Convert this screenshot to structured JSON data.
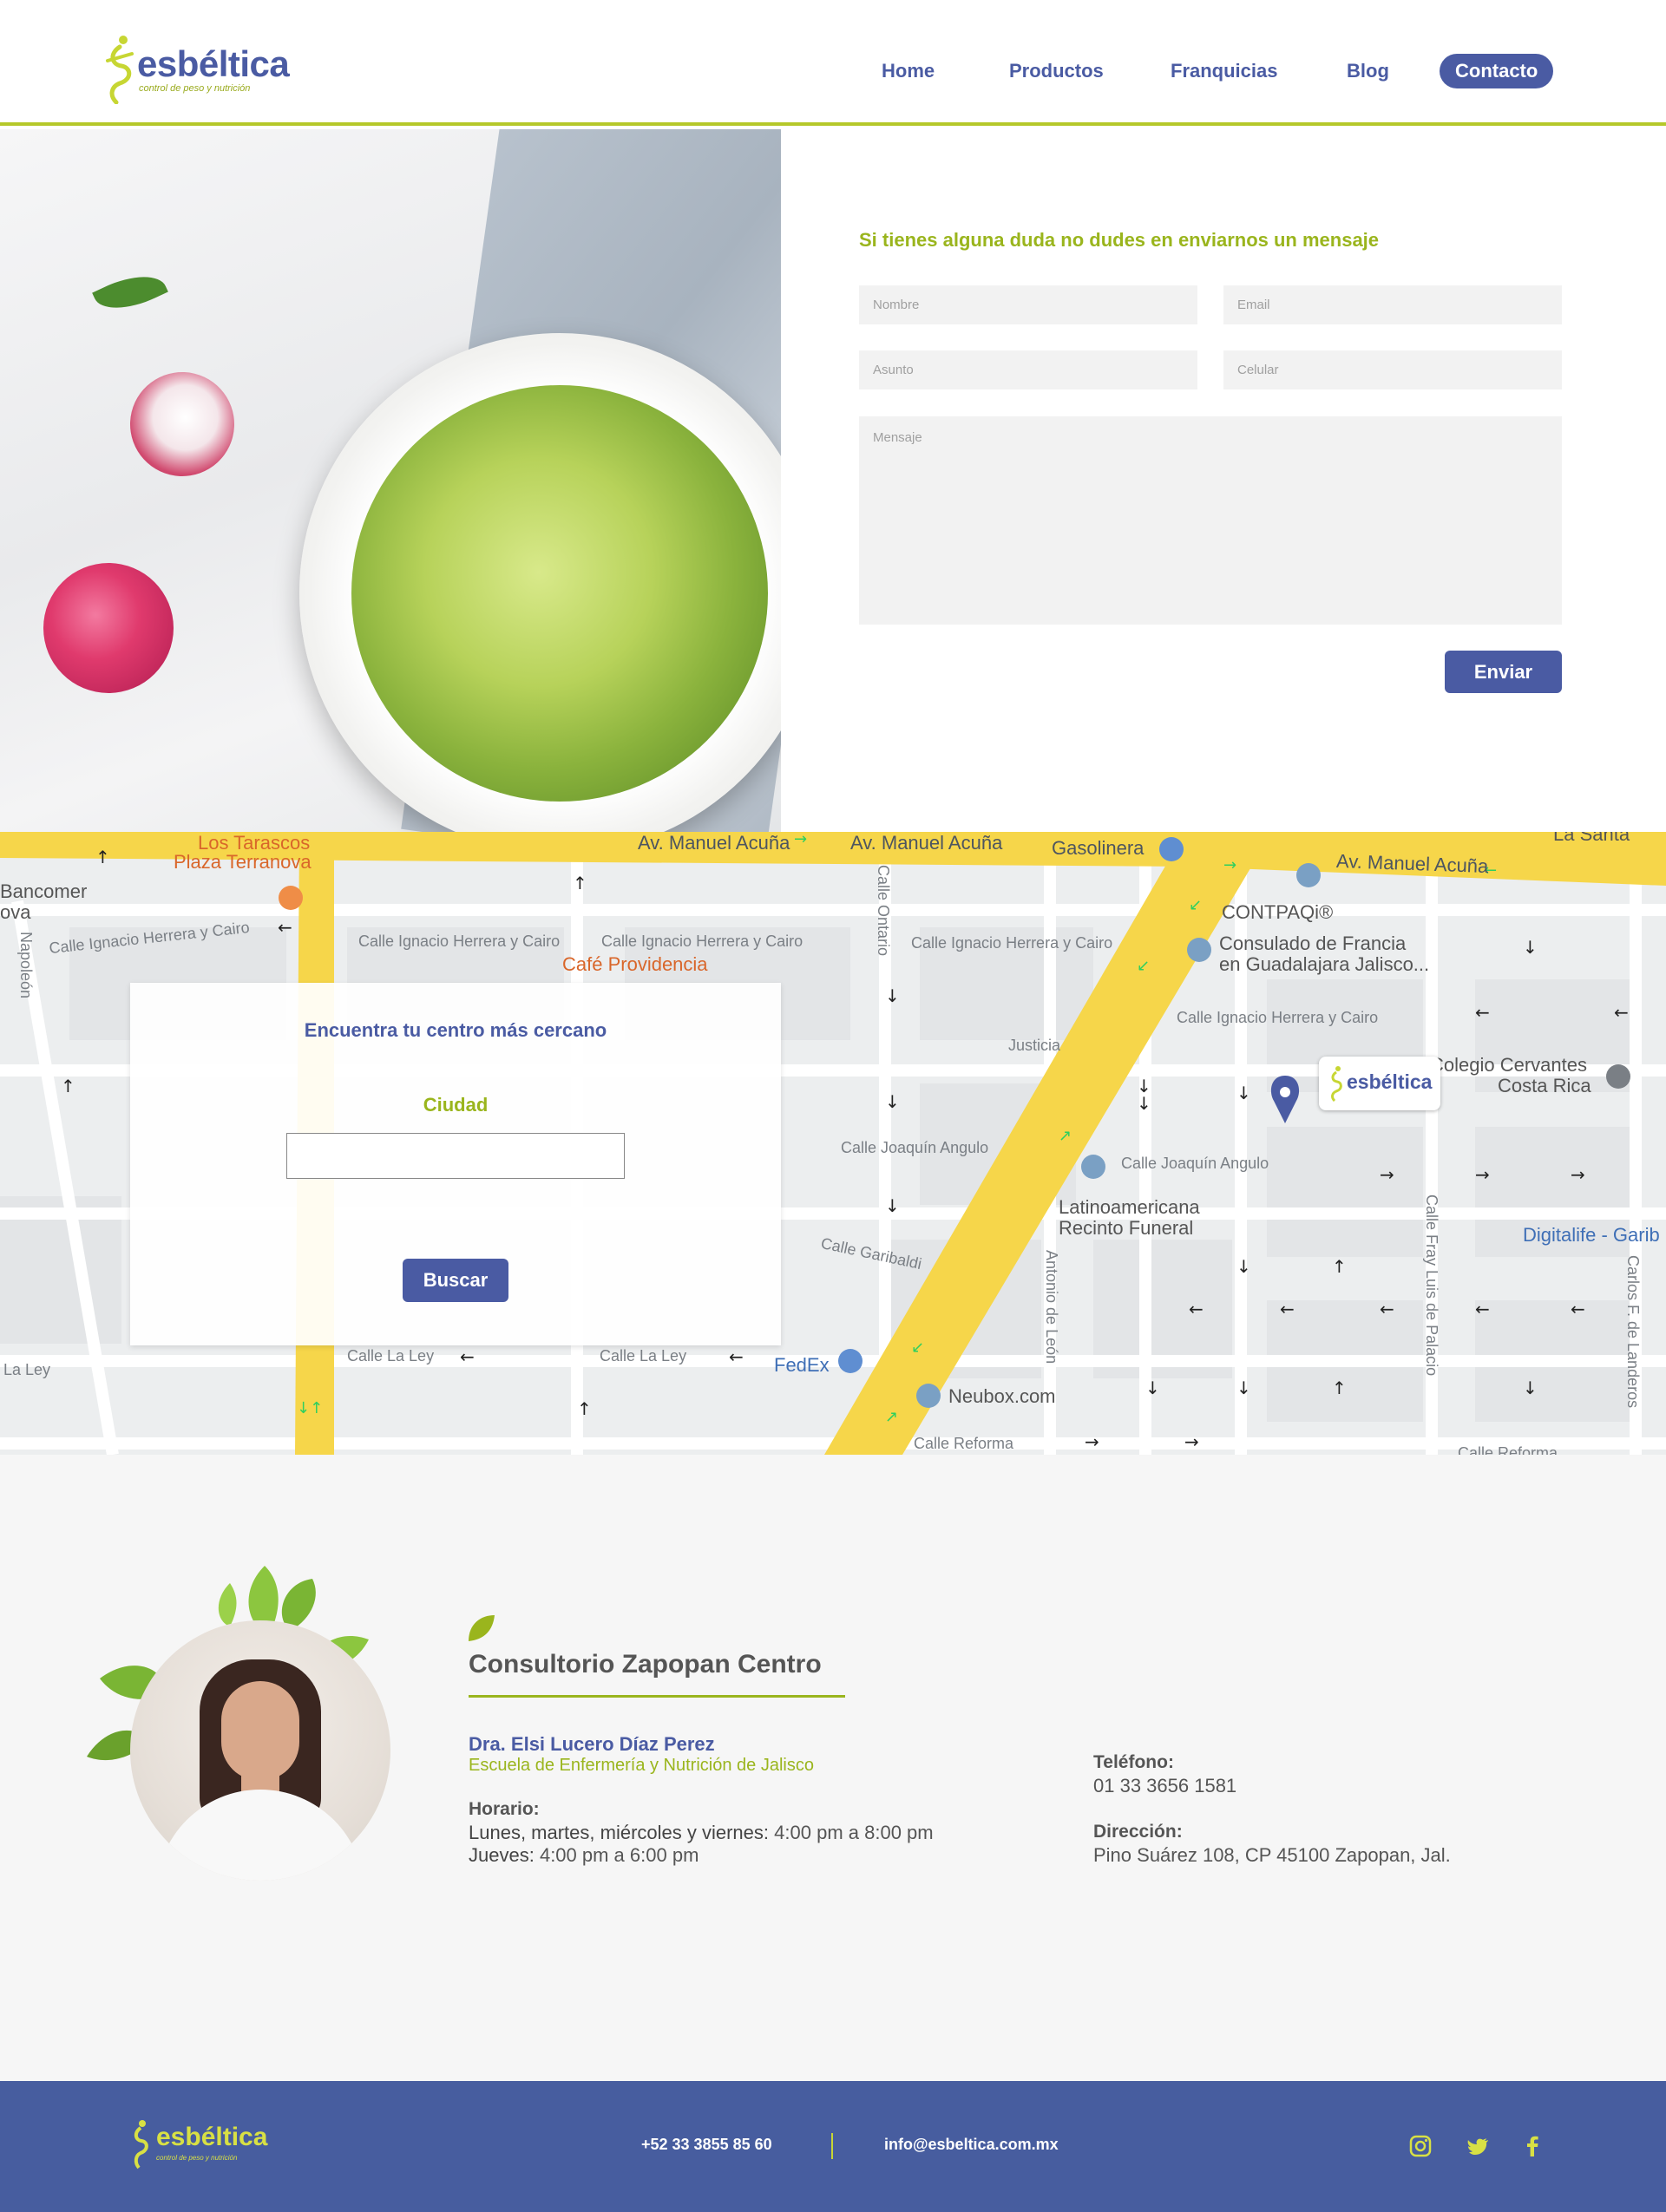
{
  "brand": {
    "name": "esbéltica",
    "tagline": "control de peso y nutrición"
  },
  "nav": {
    "items": [
      "Home",
      "Productos",
      "Franquicias",
      "Blog"
    ],
    "contact": "Contacto"
  },
  "contact_form": {
    "title": "Si tienes alguna duda no dudes en enviarnos un mensaje",
    "placeholders": {
      "name": "Nombre",
      "email": "Email",
      "subject": "Asunto",
      "phone": "Celular",
      "message": "Mensaje"
    },
    "submit": "Enviar"
  },
  "map": {
    "labels": {
      "los_tarascos": "Los Tarascos",
      "plaza_terranova": "Plaza Terranova",
      "bancomer": "Bancomer",
      "ova": "ova",
      "napoleon": "Napoleón",
      "calle_ignacio_1": "Calle Ignacio Herrera y Cairo",
      "calle_ignacio_2": "Calle Ignacio Herrera y Cairo",
      "calle_ignacio_3": "Calle Ignacio Herrera y Cairo",
      "calle_ignacio_4": "Calle Ignacio Herrera y Cairo",
      "calle_ignacio_5": "Calle Ignacio Herrera y Cairo",
      "cafe_providencia": "Café Providencia",
      "av_manuel_acuna_1": "Av. Manuel Acuña",
      "av_manuel_acuna_2": "Av. Manuel Acuña",
      "av_manuel_acuna_3": "Av. Manuel Acuña",
      "gasolinera": "Gasolinera",
      "contpaqi": "CONTPAQi®",
      "consulado_1": "Consulado de Francia",
      "consulado_2": "en Guadalajara Jalisco...",
      "la_santa": "La Santa",
      "calle_ontario": "Calle Ontario",
      "justicia": "Justicia",
      "colegio_1": "Colegio Cervantes",
      "colegio_2": "Costa Rica",
      "calle_joaquin_1": "Calle Joaquín Angulo",
      "calle_joaquin_2": "Calle Joaquín Angulo",
      "latinoamericana_1": "Latinoamericana",
      "latinoamericana_2": "Recinto Funeral",
      "digitalife": "Digitalife - Garib",
      "calle_garibaldi": "Calle Garibaldi",
      "antonio_de_leon": "Antonio de León",
      "calle_fray": "Calle Fray Luis de Palacio",
      "carlos_landeros": "Carlos F. de Landeros",
      "fedex": "FedEx",
      "neubox": "Neubox.com",
      "calle_la_ley_1": "Calle La Ley",
      "calle_la_ley_2": "Calle La Ley",
      "la_ley": "La Ley",
      "calle_reforma_1": "Calle Reforma",
      "calle_reforma_2": "Calle Reforma"
    },
    "marker_logo": "esbéltica"
  },
  "finder": {
    "title": "Encuentra tu centro más cercano",
    "city_label": "Ciudad",
    "city_value": "",
    "button": "Buscar"
  },
  "office": {
    "title": "Consultorio Zapopan Centro",
    "doctor": "Dra. Elsi Lucero Díaz Perez",
    "school": "Escuela de Enfermería y Nutrición de Jalisco",
    "hours_label": "Horario:",
    "hours_1_days": "Lunes, martes, miércoles y viernes:",
    "hours_1_time": "4:00 pm a 8:00 pm",
    "hours_2_days": "Jueves:",
    "hours_2_time": "4:00 pm a 6:00 pm",
    "phone_label": "Teléfono:",
    "phone": "01 33 3656 1581",
    "address_label": "Dirección:",
    "address": "Pino Suárez 108, CP 45100 Zapopan, Jal."
  },
  "footer": {
    "phone": "+52 33 3855 85 60",
    "email": "info@esbeltica.com.mx",
    "social": [
      "instagram-icon",
      "twitter-icon",
      "facebook-icon"
    ]
  },
  "colors": {
    "primary": "#4a5ba3",
    "accent": "#9ab51d",
    "footer_bg": "#475d9f",
    "map_road": "#f6d64a"
  }
}
